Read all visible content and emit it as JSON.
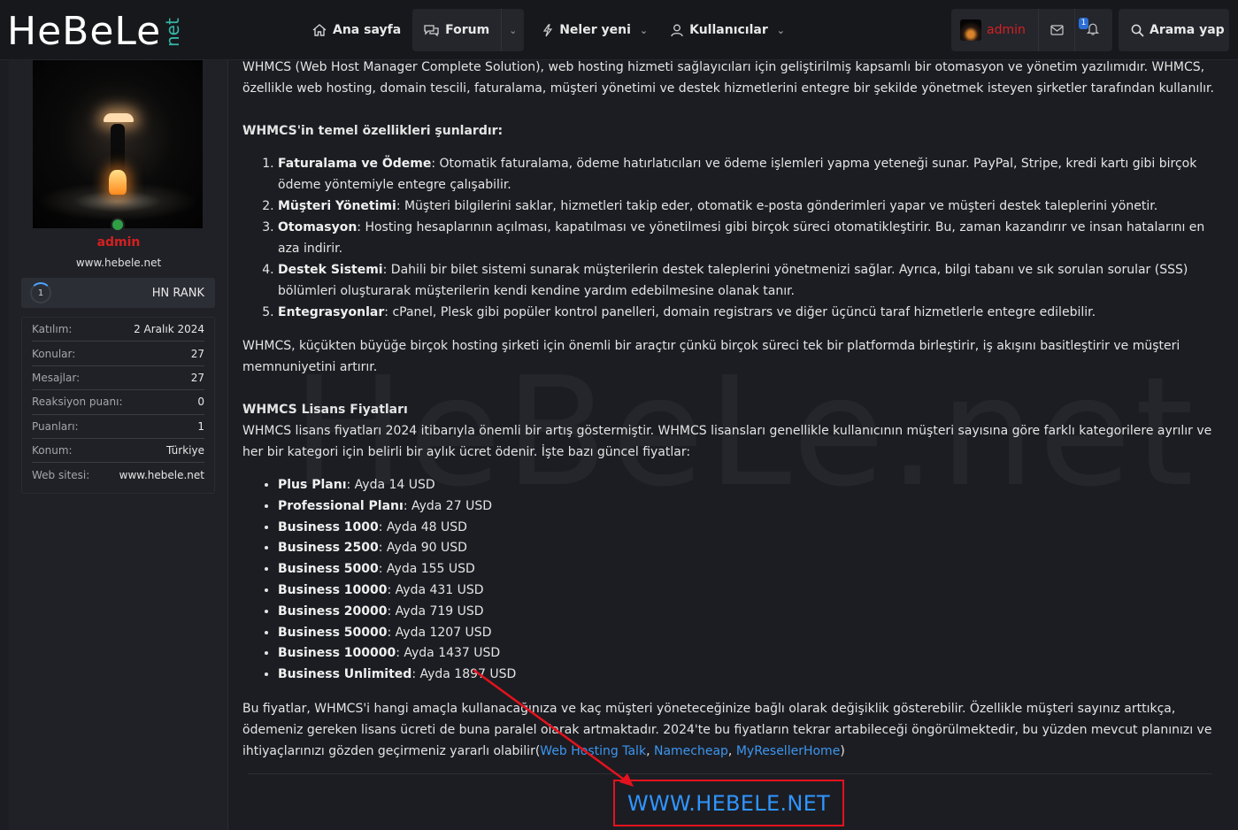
{
  "header": {
    "logo_main": "HeBeLe",
    "logo_net": "net",
    "nav": [
      {
        "label": "Ana sayfa",
        "icon": "home-icon"
      },
      {
        "label": "Forum",
        "icon": "chat-icon"
      },
      {
        "label": "Neler yeni",
        "icon": "bolt-icon"
      },
      {
        "label": "Kullanıcılar",
        "icon": "user-icon"
      }
    ],
    "user": {
      "name": "admin",
      "notification_count": "1"
    },
    "search_label": "Arama yap"
  },
  "sidebar": {
    "name": "admin",
    "website": "www.hebele.net",
    "rank_level": "1",
    "rank_label": "HN RANK",
    "stats": [
      {
        "label": "Katılım:",
        "value": "2 Aralık 2024"
      },
      {
        "label": "Konular:",
        "value": "27"
      },
      {
        "label": "Mesajlar:",
        "value": "27"
      },
      {
        "label": "Reaksiyon puanı:",
        "value": "0"
      },
      {
        "label": "Puanları:",
        "value": "1"
      },
      {
        "label": "Konum:",
        "value": "Türkiye"
      },
      {
        "label": "Web sitesi:",
        "value": "www.hebele.net"
      }
    ]
  },
  "post": {
    "intro": "WHMCS (Web Host Manager Complete Solution), web hosting hizmeti sağlayıcıları için geliştirilmiş kapsamlı bir otomasyon ve yönetim yazılımıdır. WHMCS, özellikle web hosting, domain tescili, faturalama, müşteri yönetimi ve destek hizmetlerini entegre bir şekilde yönetmek isteyen şirketler tarafından kullanılır.",
    "features_heading": "WHMCS'in temel özellikleri şunlardır:",
    "features": [
      {
        "title": "Faturalama ve Ödeme",
        "text": ": Otomatik faturalama, ödeme hatırlatıcıları ve ödeme işlemleri yapma yeteneği sunar. PayPal, Stripe, kredi kartı gibi birçok ödeme yöntemiyle entegre çalışabilir."
      },
      {
        "title": "Müşteri Yönetimi",
        "text": ": Müşteri bilgilerini saklar, hizmetleri takip eder, otomatik e-posta gönderimleri yapar ve müşteri destek taleplerini yönetir."
      },
      {
        "title": "Otomasyon",
        "text": ": Hosting hesaplarının açılması, kapatılması ve yönetilmesi gibi birçok süreci otomatikleştirir. Bu, zaman kazandırır ve insan hatalarını en aza indirir."
      },
      {
        "title": "Destek Sistemi",
        "text": ": Dahili bir bilet sistemi sunarak müşterilerin destek taleplerini yönetmenizi sağlar. Ayrıca, bilgi tabanı ve sık sorulan sorular (SSS) bölümleri oluşturarak müşterilerin kendi kendine yardım edebilmesine olanak tanır."
      },
      {
        "title": "Entegrasyonlar",
        "text": ": cPanel, Plesk gibi popüler kontrol panelleri, domain registrars ve diğer üçüncü taraf hizmetlerle entegre edilebilir."
      }
    ],
    "summary": "WHMCS, küçükten büyüğe birçok hosting şirketi için önemli bir araçtır çünkü birçok süreci tek bir platformda birleştirir, iş akışını basitleştirir ve müşteri memnuniyetini artırır.",
    "pricing_heading": "WHMCS Lisans Fiyatları",
    "pricing_intro": "WHMCS lisans fiyatları 2024 itibarıyla önemli bir artış göstermiştir. WHMCS lisansları genellikle kullanıcının müşteri sayısına göre farklı kategorilere ayrılır ve her bir kategori için belirli bir aylık ücret ödenir. İşte bazı güncel fiyatlar:",
    "prices": [
      {
        "plan": "Plus Planı",
        "price": ": Ayda 14 USD"
      },
      {
        "plan": "Professional Planı",
        "price": ": Ayda 27 USD"
      },
      {
        "plan": "Business 1000",
        "price": ": Ayda 48 USD"
      },
      {
        "plan": "Business 2500",
        "price": ": Ayda 90 USD"
      },
      {
        "plan": "Business 5000",
        "price": ": Ayda 155 USD"
      },
      {
        "plan": "Business 10000",
        "price": ": Ayda 431 USD"
      },
      {
        "plan": "Business 20000",
        "price": ": Ayda 719 USD"
      },
      {
        "plan": "Business 50000",
        "price": ": Ayda 1207 USD"
      },
      {
        "plan": "Business 100000",
        "price": ": Ayda 1437 USD"
      },
      {
        "plan": "Business Unlimited",
        "price": ": Ayda 1897 USD"
      }
    ],
    "closing": "Bu fiyatlar, WHMCS'i hangi amaçla kullanacağınıza ve kaç müşteri yöneteceğinize bağlı olarak değişiklik gösterebilir. Özellikle müşteri sayınız arttıkça, ödemeniz gereken lisans ücreti de buna paralel olarak artmaktadır. 2024'te bu fiyatların tekrar artabileceği öngörülmektedir, bu yüzden mevcut planınızı ve ihtiyaçlarınızı gözden geçirmeniz yararlı olabilir(",
    "links": [
      "Web Hosting Talk",
      "Namecheap",
      "MyResellerHome"
    ],
    "link_sep": ", ",
    "closing_end": ")",
    "cta": "WWW.HEBELE.NET",
    "watermark": "HeBeLe.net"
  },
  "colors": {
    "accent": "#2f95ff",
    "admin": "#d42020",
    "cta_border": "#e3121d",
    "online": "#2f9e44"
  }
}
